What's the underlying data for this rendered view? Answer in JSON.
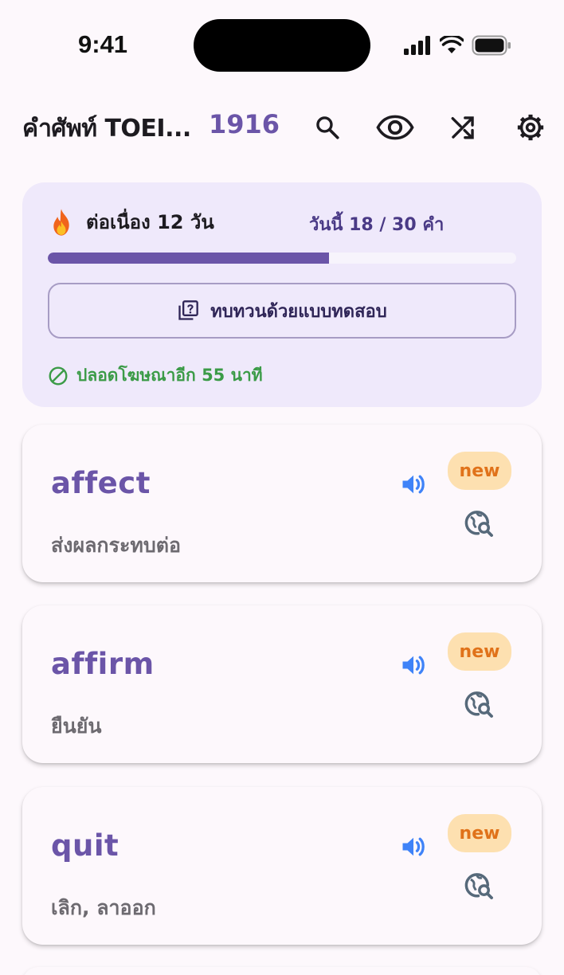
{
  "status_bar": {
    "time": "9:41"
  },
  "app_bar": {
    "title": "คำศัพท์ TOEI...",
    "word_count": "1916",
    "actions": [
      "search-icon",
      "eye-icon",
      "shuffle-icon",
      "gear-icon"
    ]
  },
  "progress": {
    "streak_text": "ต่อเนื่อง 12 วัน",
    "today_text": "วันนี้ 18 / 30 คำ",
    "done": 18,
    "goal": 30,
    "quiz_button_label": "ทบทวนด้วยแบบทดสอบ",
    "ad_free_text": "ปลอดโฆษณาอีก 55 นาที"
  },
  "words": [
    {
      "word": "affect",
      "meaning": "ส่งผลกระทบต่อ",
      "badge": "new"
    },
    {
      "word": "affirm",
      "meaning": "ยืนยัน",
      "badge": "new"
    },
    {
      "word": "quit",
      "meaning": "เลิก, ลาออก",
      "badge": "new"
    }
  ],
  "colors": {
    "primary": "#6b55a8",
    "card_bg": "#efe9fb",
    "badge_bg": "#fde0b0",
    "badge_text": "#e0721a",
    "speaker": "#3f83f8",
    "ad_free": "#3b9b47"
  }
}
